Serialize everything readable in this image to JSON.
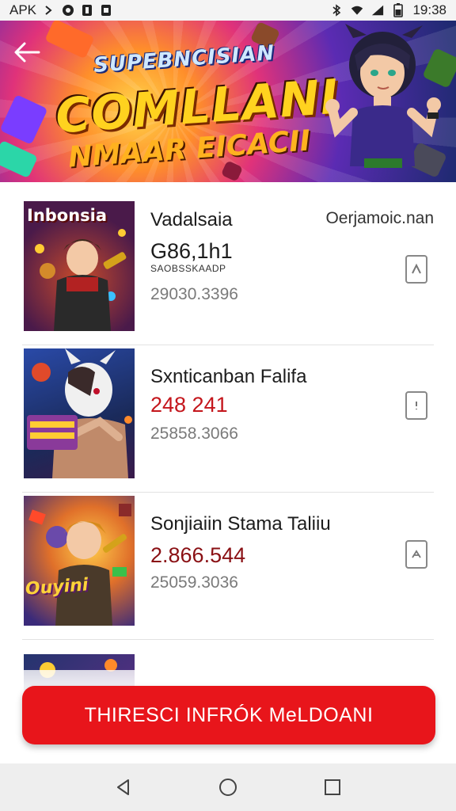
{
  "status_bar": {
    "carrier": "APK",
    "time": "19:38",
    "icons": [
      "bluetooth-icon",
      "wifi-icon",
      "signal-icon",
      "battery-icon"
    ]
  },
  "banner": {
    "line1": "SUPEBNCISIAN",
    "line2": "COMLLANI",
    "line3": "NMAAR EICACII"
  },
  "items": [
    {
      "thumb_text": "Inbonsia",
      "title": "Vadalsaia",
      "developer": "Oerjamoic.nan",
      "price": "G86,1h1",
      "subtitle": "SAOBSSKAADP",
      "meta": "29030.3396",
      "price_color": "#1c1c1c"
    },
    {
      "thumb_text": "",
      "title": "Sxnticanban Falifa",
      "developer": "",
      "price": "248 241",
      "subtitle": "",
      "meta": "25858.3066",
      "price_color": "#c4161c"
    },
    {
      "thumb_text": "Ouyini",
      "title": "Sonjiaiin Stama Taliiu",
      "developer": "",
      "price": "2.866.544",
      "subtitle": "",
      "meta": "25059.3036",
      "price_color": "#8a1014"
    }
  ],
  "cta": {
    "label": "THIRESCI INFRÓK MeLDOANI"
  }
}
